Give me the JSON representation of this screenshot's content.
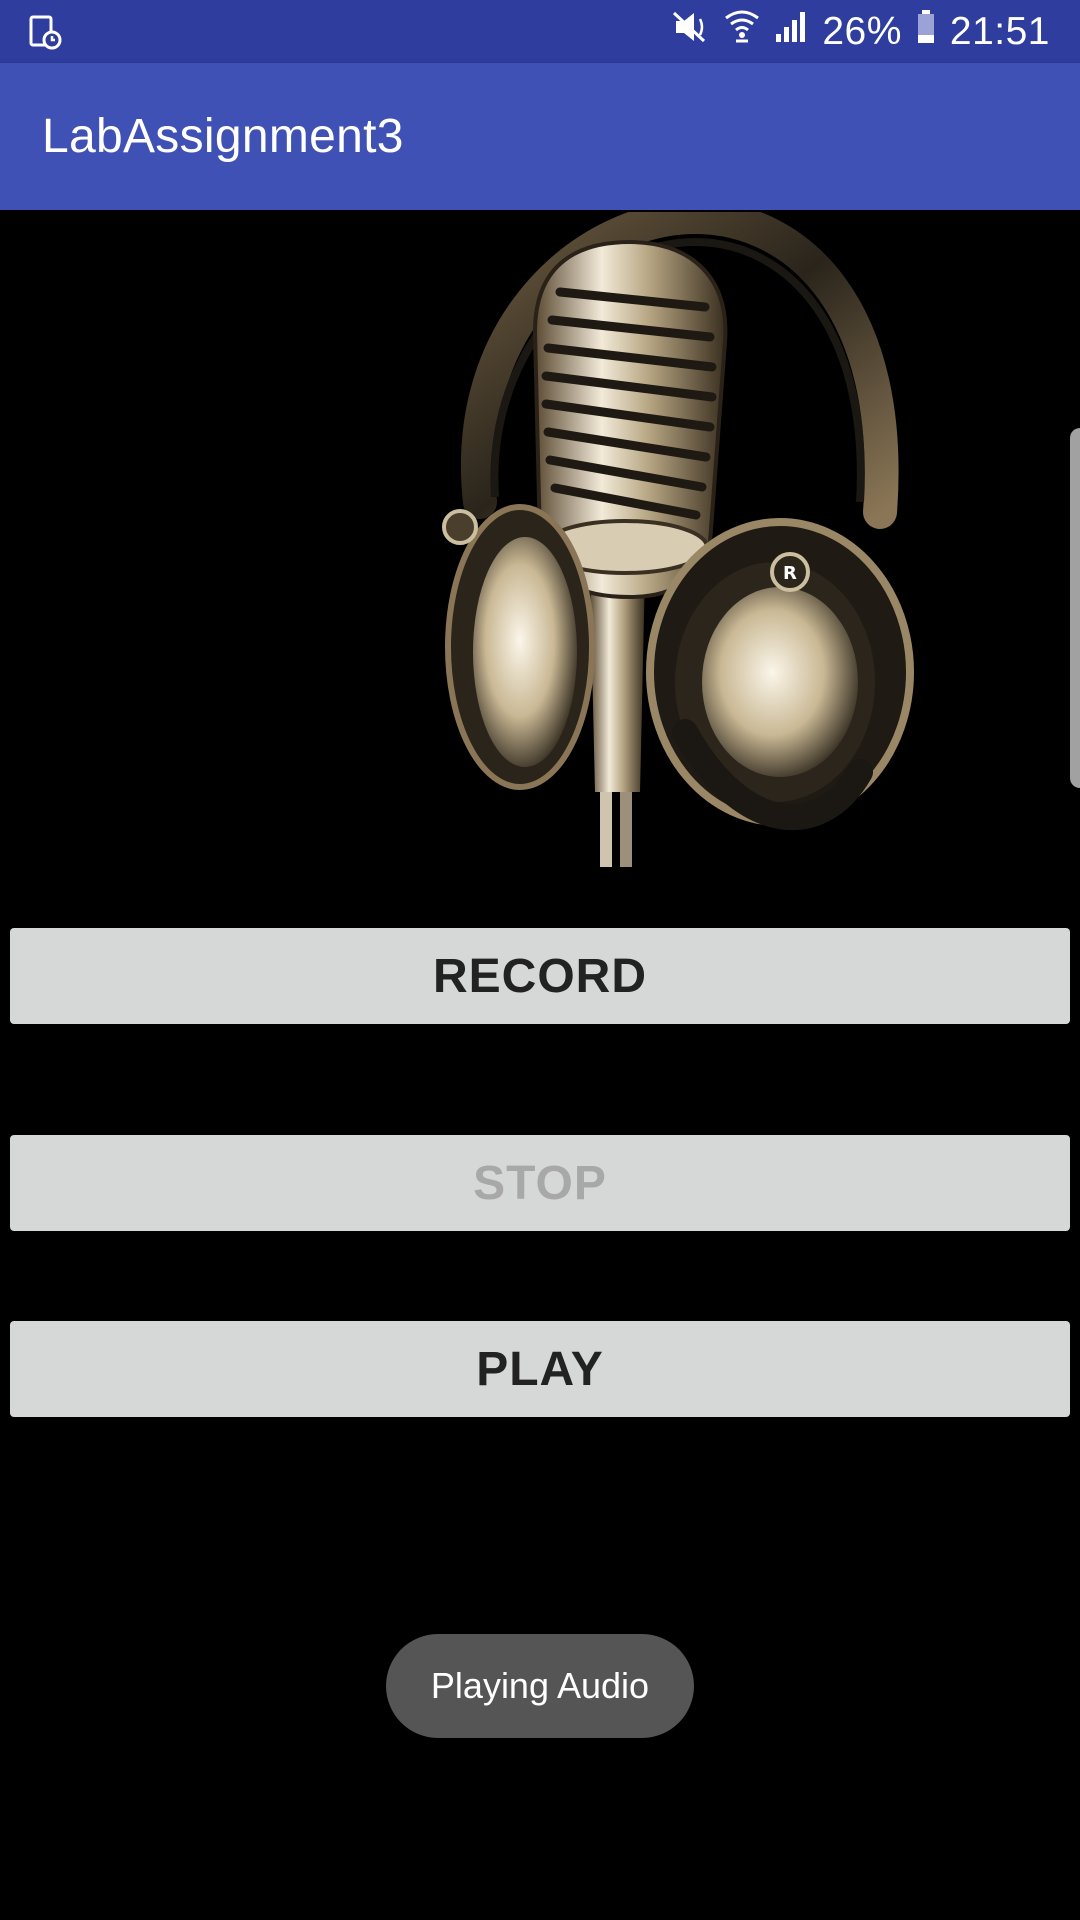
{
  "status_bar": {
    "left_icon": "screen-recorder-icon",
    "icons": [
      "vibrate-mute-icon",
      "wifi-icon",
      "signal-icon",
      "battery-icon"
    ],
    "battery": "26%",
    "time": "21:51",
    "background": "#2f3d9f"
  },
  "app_bar": {
    "title": "LabAssignment3",
    "background": "#3f51b5"
  },
  "hero_image": {
    "icon": "microphone-headphones-image"
  },
  "buttons": {
    "record": "RECORD",
    "stop": "STOP",
    "play": "PLAY"
  },
  "button_states": {
    "record_enabled": true,
    "stop_enabled": false,
    "play_enabled": true
  },
  "toast": {
    "message": "Playing Audio"
  }
}
